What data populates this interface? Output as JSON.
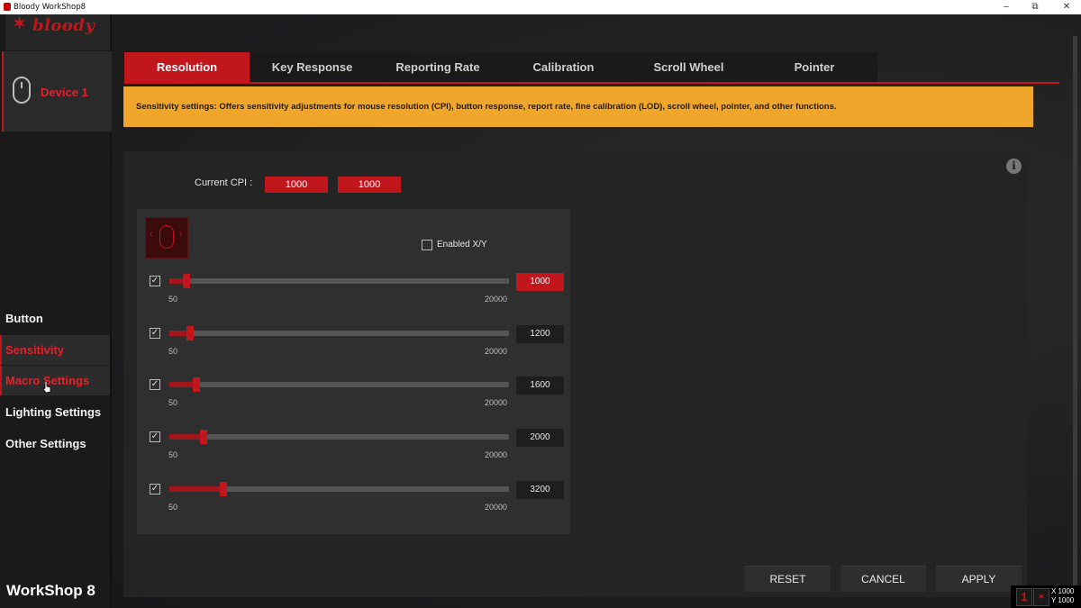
{
  "window": {
    "title": "Bloody WorkShop8",
    "minimize": "–",
    "maximize": "⧉",
    "close": "✕"
  },
  "logo": {
    "text": "bloody"
  },
  "device": {
    "label": "Device 1"
  },
  "nav": {
    "items": [
      {
        "label": "Button"
      },
      {
        "label": "Sensitivity"
      },
      {
        "label": "Macro Settings"
      },
      {
        "label": "Lighting Settings"
      },
      {
        "label": "Other Settings"
      }
    ]
  },
  "brand": "WorkShop 8",
  "tabs": [
    {
      "label": "Resolution"
    },
    {
      "label": "Key Response"
    },
    {
      "label": "Reporting Rate"
    },
    {
      "label": "Calibration"
    },
    {
      "label": "Scroll Wheel"
    },
    {
      "label": "Pointer"
    }
  ],
  "notice": "Sensitivity settings: Offers sensitivity adjustments for mouse resolution (CPI), button response, report rate, fine calibration (LOD), scroll wheel, pointer, and other functions.",
  "info_icon": "i",
  "current_cpi": {
    "label": "Current CPI :",
    "x": "1000",
    "y": "1000"
  },
  "enabled_xy": {
    "label": "Enabled X/Y",
    "checked": false
  },
  "sliders": {
    "min_label": "50",
    "max_label": "20000",
    "rows": [
      {
        "value": "1000",
        "checked": true,
        "active": true,
        "level": 0.05
      },
      {
        "value": "1200",
        "checked": true,
        "active": false,
        "level": 0.06
      },
      {
        "value": "1600",
        "checked": true,
        "active": false,
        "level": 0.08
      },
      {
        "value": "2000",
        "checked": true,
        "active": false,
        "level": 0.1
      },
      {
        "value": "3200",
        "checked": true,
        "active": false,
        "level": 0.16
      }
    ]
  },
  "buttons": {
    "reset": "RESET",
    "cancel": "CANCEL",
    "apply": "APPLY"
  },
  "tray": {
    "x": "X 1000",
    "y": "Y 1000"
  },
  "colors": {
    "accent": "#c0161c",
    "notice": "#efa62a"
  }
}
